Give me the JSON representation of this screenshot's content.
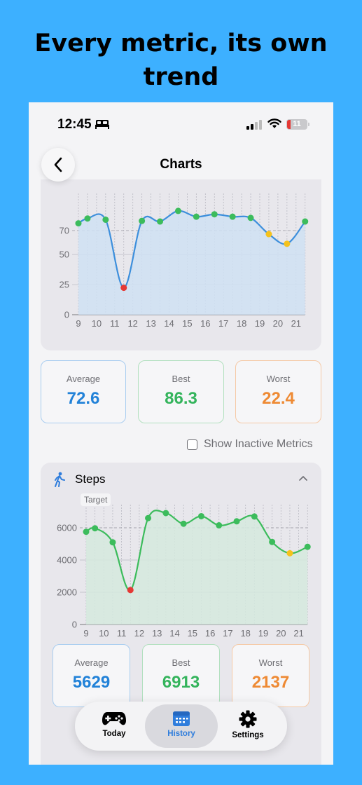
{
  "headline": "Every metric, its own trend",
  "status_bar": {
    "time": "12:45",
    "battery": "11"
  },
  "nav": {
    "title": "Charts"
  },
  "chart_data": [
    {
      "type": "line",
      "x": [
        9,
        9.5,
        10.5,
        11.5,
        12.5,
        13.5,
        14.5,
        15.5,
        16.5,
        17.5,
        18.5,
        19.5,
        20.5,
        21.5
      ],
      "xticks": [
        "9",
        "10",
        "11",
        "12",
        "13",
        "14",
        "15",
        "16",
        "17",
        "18",
        "19",
        "20",
        "21"
      ],
      "series": [
        {
          "values": [
            76,
            80,
            79,
            22.4,
            78,
            77.5,
            86.3,
            81.5,
            83.5,
            81.5,
            80.5,
            67,
            59,
            77.5
          ]
        }
      ],
      "yticks": [
        0,
        25,
        50,
        70
      ],
      "ylim": [
        0,
        95
      ],
      "target": 70,
      "colors": {
        "line": "#3d8fdc",
        "fill": "#cfe0f3",
        "normal": "#3cbc5c",
        "warn": "#f5c21c",
        "bad": "#e53935"
      },
      "point_status": [
        "normal",
        "normal",
        "normal",
        "bad",
        "normal",
        "normal",
        "normal",
        "normal",
        "normal",
        "normal",
        "normal",
        "warn",
        "warn",
        "normal"
      ]
    },
    {
      "type": "line",
      "x": [
        9,
        9.5,
        10.5,
        11.5,
        12.5,
        13.5,
        14.5,
        15.5,
        16.5,
        17.5,
        18.5,
        19.5,
        20.5,
        21.5
      ],
      "xticks": [
        "9",
        "10",
        "11",
        "12",
        "13",
        "14",
        "15",
        "16",
        "17",
        "18",
        "19",
        "20",
        "21"
      ],
      "series": [
        {
          "name": "Steps",
          "values": [
            5750,
            5970,
            5100,
            2137,
            6600,
            6913,
            6250,
            6720,
            6150,
            6400,
            6700,
            5120,
            4420,
            4820
          ]
        }
      ],
      "yticks": [
        0,
        2000,
        4000,
        6000
      ],
      "ylim": [
        0,
        7000
      ],
      "target": 6000,
      "target_label": "Target",
      "colors": {
        "line": "#3cbc5c",
        "fill": "#d5e9de",
        "normal": "#3cbc5c",
        "warn": "#f5c21c",
        "bad": "#e53935"
      },
      "point_status": [
        "normal",
        "normal",
        "normal",
        "bad",
        "normal",
        "normal",
        "normal",
        "normal",
        "normal",
        "normal",
        "normal",
        "normal",
        "warn",
        "normal"
      ]
    }
  ],
  "metric1_stats": {
    "average_label": "Average",
    "average": "72.6",
    "best_label": "Best",
    "best": "86.3",
    "worst_label": "Worst",
    "worst": "22.4"
  },
  "show_inactive": {
    "label": "Show Inactive Metrics",
    "checked": false
  },
  "steps": {
    "title": "Steps",
    "icon": "walking-icon"
  },
  "steps_stats": {
    "average_label": "Average",
    "average": "5629",
    "best_label": "Best",
    "best": "6913",
    "worst_label": "Worst",
    "worst": "2137"
  },
  "tabs": [
    {
      "label": "Today",
      "icon": "gamepad-icon",
      "active": false
    },
    {
      "label": "History",
      "icon": "calendar-icon",
      "active": true
    },
    {
      "label": "Settings",
      "icon": "gear-icon",
      "active": false
    }
  ]
}
